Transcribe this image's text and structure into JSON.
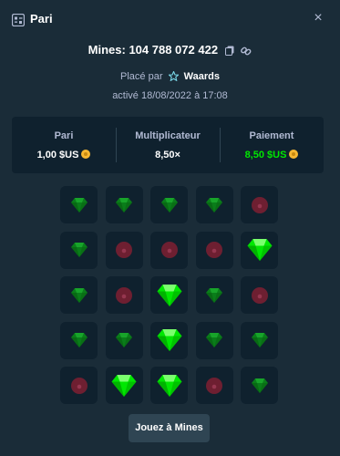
{
  "header": {
    "title": "Pari",
    "close_symbol": "×"
  },
  "bet": {
    "mines_id": "Mines: 104 788 072 422",
    "placed_by_prefix": "Placé par",
    "user": "Waards",
    "activated": "activé 18/08/2022 à 17:08"
  },
  "stats": {
    "bet_label": "Pari",
    "bet_value": "1,00 $US",
    "multiplier_label": "Multiplicateur",
    "multiplier_value": "8,50×",
    "payout_label": "Paiement",
    "payout_value": "8,50 $US"
  },
  "grid": [
    [
      "gem-dim",
      "gem-dim",
      "gem-dim",
      "gem-dim",
      "mine-dim"
    ],
    [
      "gem-dim",
      "mine-dim",
      "mine-dim",
      "mine-dim",
      "gem"
    ],
    [
      "gem-dim",
      "mine-dim",
      "gem",
      "gem-dim",
      "mine-dim"
    ],
    [
      "gem-dim",
      "gem-dim",
      "gem",
      "gem-dim",
      "gem-dim"
    ],
    [
      "mine-dim",
      "gem",
      "gem",
      "mine-dim",
      "gem-dim"
    ]
  ],
  "play_button": "Jouez à Mines",
  "colors": {
    "background": "#1a2c38",
    "panel": "#0f212e",
    "accent_green": "#00e701",
    "gem": "#00e701",
    "gem_dim": "#0a7d1a",
    "mine_dim": "#6e1f31"
  },
  "icons": {
    "header": "bet-slip-icon",
    "close": "close-icon",
    "copy": "copy-icon",
    "link": "link-icon",
    "user": "vip-star-icon",
    "currency": "coin-icon",
    "gem": "gem-icon",
    "mine": "mine-icon"
  }
}
